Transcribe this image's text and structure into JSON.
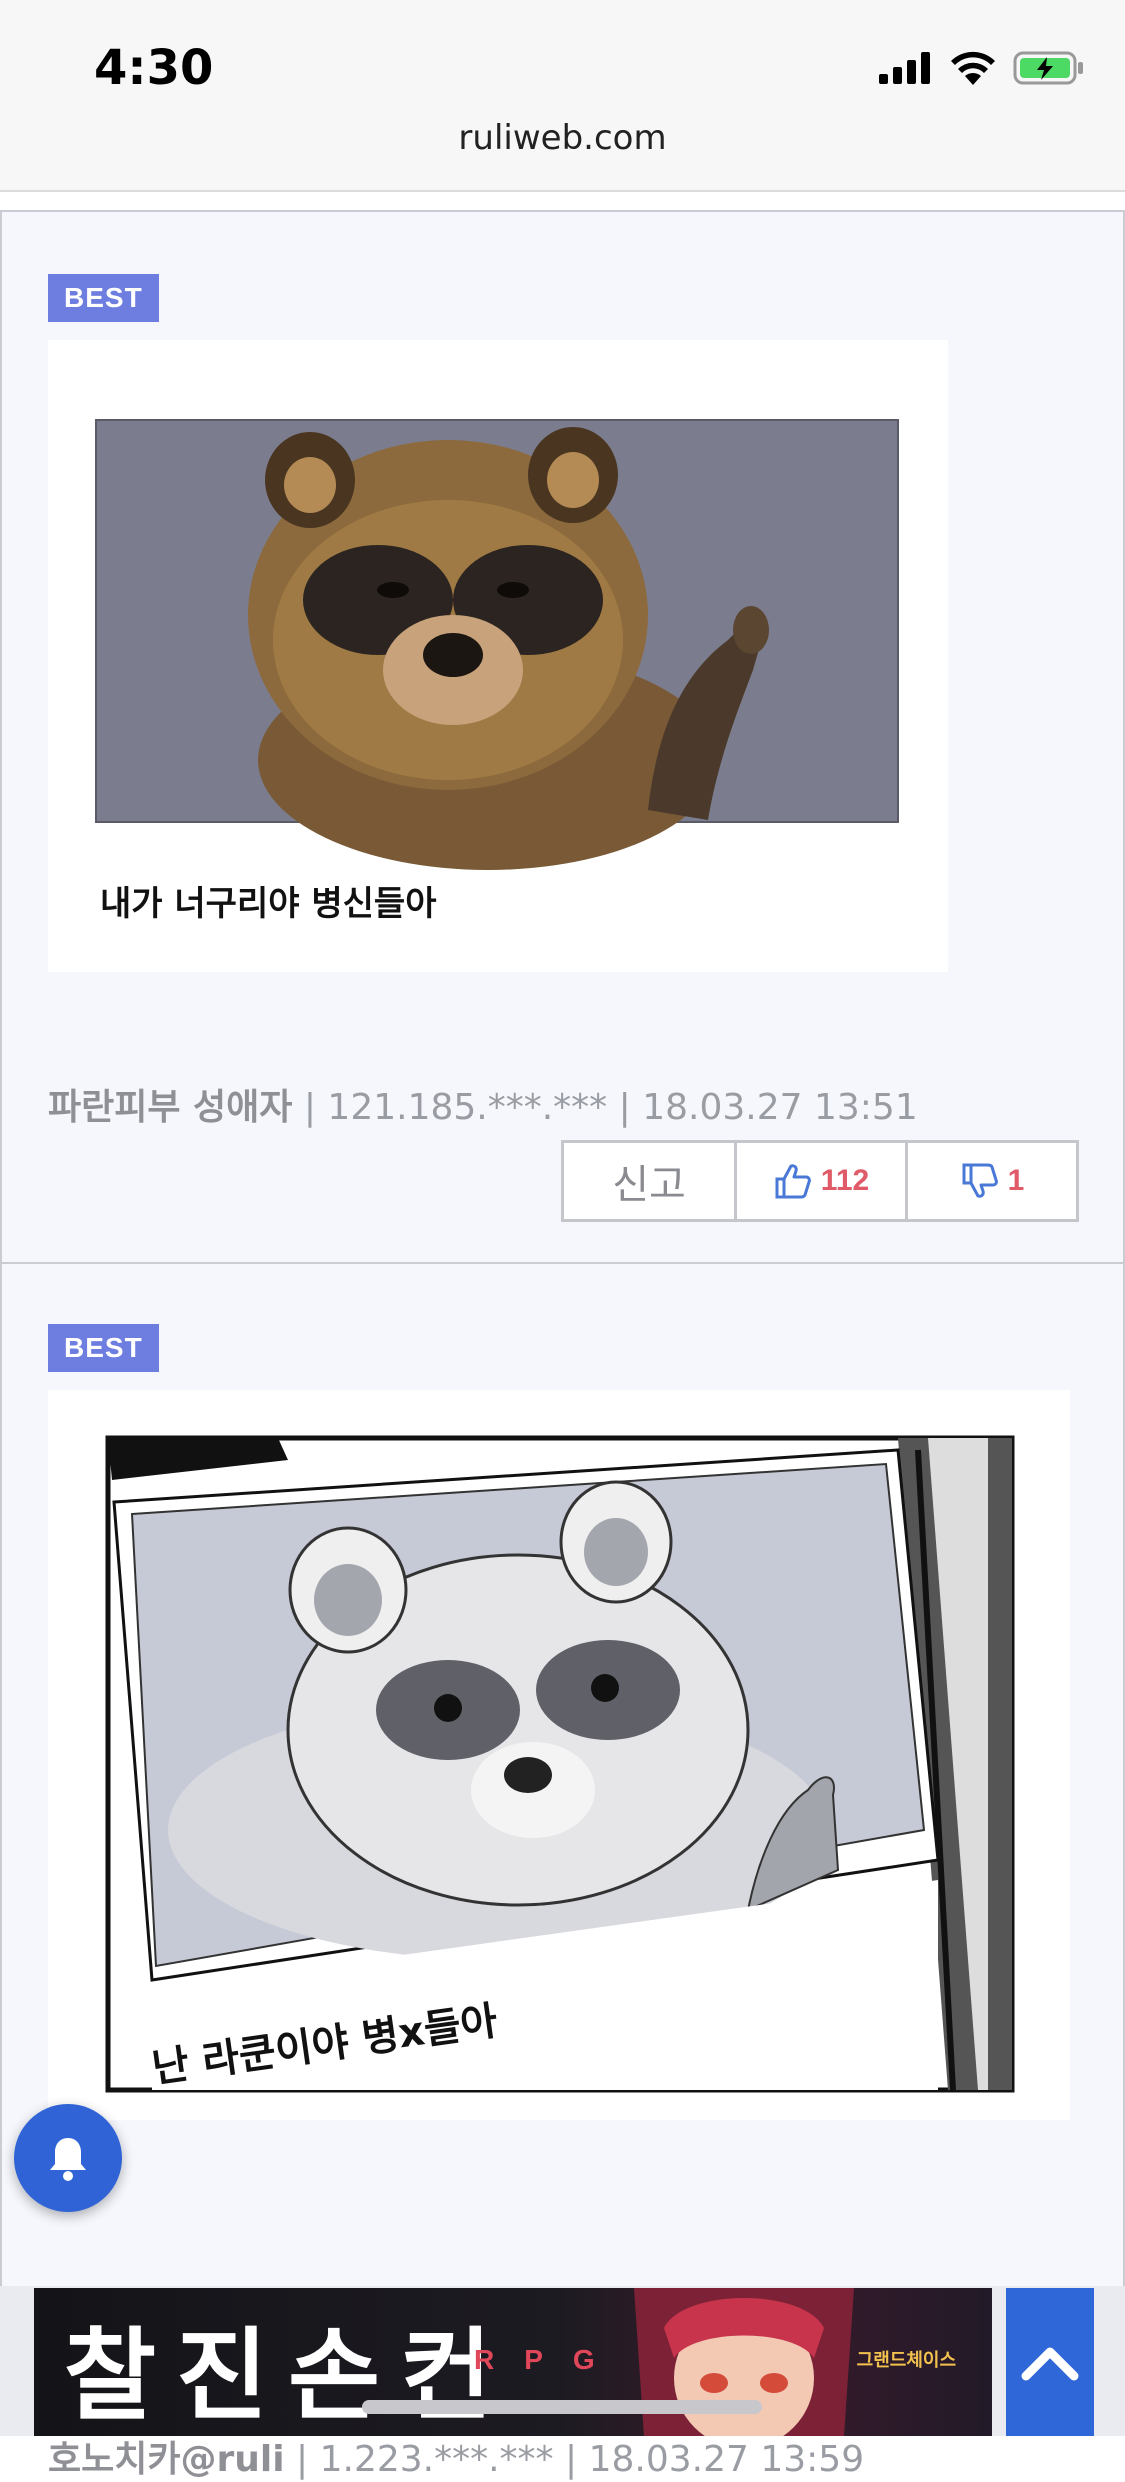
{
  "status_bar": {
    "time": "4:30",
    "url": "ruliweb.com",
    "icons": [
      "cellular-signal-icon",
      "wifi-icon",
      "battery-charging-icon"
    ]
  },
  "posts": [
    {
      "badge": "BEST",
      "image_caption": "내가 너구리야 병신들아",
      "author": "파란피부 성애자",
      "ip": "121.185.***.***",
      "datetime": "18.03.27 13:51",
      "report_label": "신고",
      "likes": "112",
      "dislikes": "1"
    },
    {
      "badge": "BEST",
      "image_caption": "난 라쿤이야 병x들아",
      "author": "호노치카@ruli",
      "ip": "1.223.***.***",
      "datetime": "18.03.27 13:59"
    }
  ],
  "separator": "|",
  "ad": {
    "title": "찰진손컨",
    "subtitle": "RPG",
    "logo_text": "그랜드체이스"
  },
  "icons": {
    "bell": "bell-icon",
    "scroll_top": "chevron-up-icon",
    "thumb_up": "thumbs-up-icon",
    "thumb_down": "thumbs-down-icon"
  },
  "colors": {
    "badge": "#6e7de0",
    "vote_count": "#e05a68",
    "fab": "#2f63d6"
  }
}
